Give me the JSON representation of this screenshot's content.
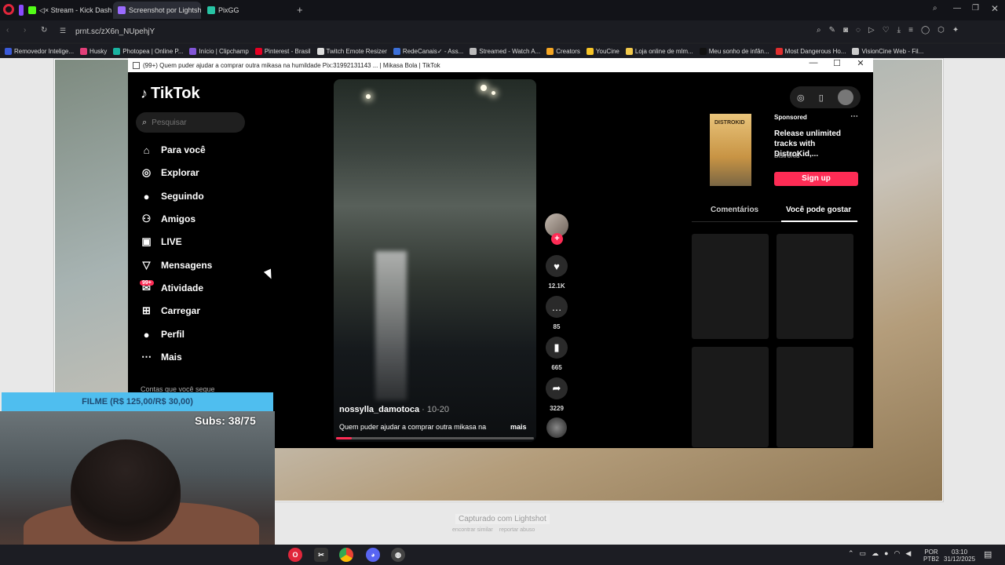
{
  "browser": {
    "tabs": [
      {
        "label": "◁× Stream - Kick Dashbo...",
        "active": false,
        "color": "#53fc18"
      },
      {
        "label": "Screenshot por Lightshot",
        "active": true,
        "color": "#9b6bff"
      },
      {
        "label": "PixGG",
        "active": false,
        "color": "#27c3a4"
      }
    ],
    "new_tab": "+",
    "url": "prnt.sc/zX6n_NUpehjY",
    "bookmarks": [
      {
        "label": "Removedor Intelige...",
        "color": "#3a5ad9"
      },
      {
        "label": "Husky",
        "color": "#e23f79"
      },
      {
        "label": "Photopea | Online P...",
        "color": "#19b3a0"
      },
      {
        "label": "Início | Clipchamp",
        "color": "#8155d6"
      },
      {
        "label": "Pinterest - Brasil",
        "color": "#e60023"
      },
      {
        "label": "Twitch Emote Resizer",
        "color": "#dddddd"
      },
      {
        "label": "RedeCanais✓ - Ass...",
        "color": "#3b6fd8"
      },
      {
        "label": "Streamed - Watch A...",
        "color": "#bbbbbb"
      },
      {
        "label": "Creators",
        "color": "#f5a623"
      },
      {
        "label": "YouCine",
        "color": "#f7c427"
      },
      {
        "label": "Loja online de mlm...",
        "color": "#f2c94c"
      },
      {
        "label": "Meu sonho de infân...",
        "color": "#111111"
      },
      {
        "label": "Most Dangerous Ho...",
        "color": "#e02e2e"
      },
      {
        "label": "VisionCine Web - Fil...",
        "color": "#cccccc"
      }
    ]
  },
  "inner_window": {
    "title": "(99+) Quem puder ajudar a comprar outra mikasa na humildade Pix:31992131143 ... | Mikasa Bola | TikTok"
  },
  "tiktok": {
    "logo": "TikTok",
    "search_placeholder": "Pesquisar",
    "nav": [
      {
        "label": "Para você",
        "icon": "home-icon",
        "glyph": "⌂"
      },
      {
        "label": "Explorar",
        "icon": "compass-icon",
        "glyph": "◎"
      },
      {
        "label": "Seguindo",
        "icon": "avatar-icon",
        "glyph": "●"
      },
      {
        "label": "Amigos",
        "icon": "friends-icon",
        "glyph": "⚇"
      },
      {
        "label": "LIVE",
        "icon": "live-icon",
        "glyph": "▣"
      },
      {
        "label": "Mensagens",
        "icon": "send-icon",
        "glyph": "▽"
      },
      {
        "label": "Atividade",
        "icon": "inbox-icon",
        "glyph": "✉"
      },
      {
        "label": "Carregar",
        "icon": "upload-icon",
        "glyph": "⊞"
      },
      {
        "label": "Perfil",
        "icon": "profile-icon",
        "glyph": "●"
      },
      {
        "label": "Mais",
        "icon": "more-icon",
        "glyph": "⋯"
      }
    ],
    "activity_badge": "99+",
    "following_title": "Contas que você segue",
    "video": {
      "username": "nossylla_damotoca",
      "date": " · 10-20",
      "caption": "Quem puder ajudar a comprar outra mikasa na",
      "more": "mais",
      "progress": 0.08
    },
    "rail": {
      "likes": "12.1K",
      "comments": "85",
      "saves": "665",
      "shares": "3229"
    },
    "ad": {
      "sponsored": "Sponsored",
      "title": "Release unlimited tracks with DistroKid,...",
      "brand": "DistroKid",
      "image_label": "DISTROKID",
      "cta": "Sign up"
    },
    "panel_tabs": [
      "Comentários",
      "Você pode gostar"
    ]
  },
  "lightshot": {
    "captured": "Capturado com Lightshot",
    "links": [
      "encontrar similar",
      "reportar abuso"
    ]
  },
  "stream": {
    "donation": "FILME (R$ 125,00/R$ 30,00)",
    "subs": "Subs: 38/75"
  },
  "taskbar": {
    "lang": "POR",
    "lang2": "PTB2",
    "time": "03:10",
    "date": "31/12/2025"
  }
}
